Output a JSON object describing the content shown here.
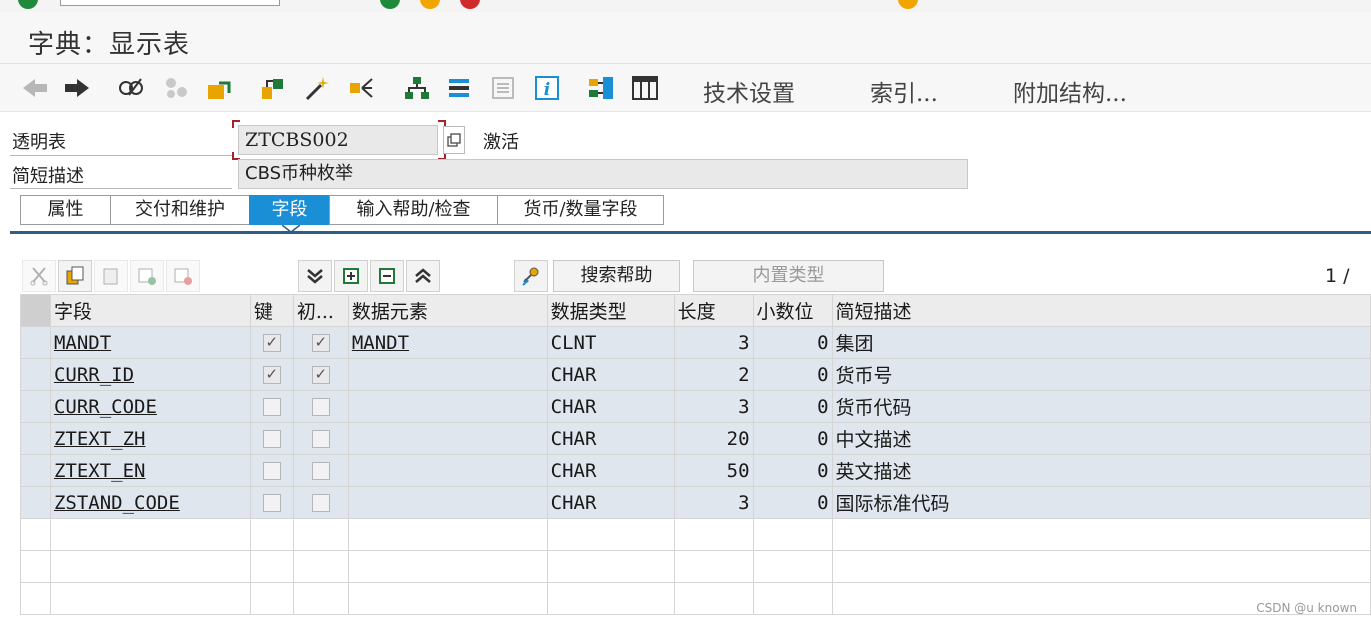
{
  "window": {
    "title": "字典：显示表"
  },
  "app_toolbar": {
    "tech_settings": "技术设置",
    "indexes": "索引...",
    "append_structures": "附加结构..."
  },
  "header": {
    "table_label": "透明表",
    "table_name": "ZTCBS002",
    "status": "激活",
    "desc_label": "简短描述",
    "desc_value": "CBS币种枚举"
  },
  "tabs": [
    "属性",
    "交付和维护",
    "字段",
    "输入帮助/检查",
    "货币/数量字段"
  ],
  "active_tab": "字段",
  "table_toolbar": {
    "search_help": "搜索帮助",
    "builtin_type": "内置类型",
    "pager": "1 /"
  },
  "columns": [
    "字段",
    "键",
    "初...",
    "数据元素",
    "数据类型",
    "长度",
    "小数位",
    "简短描述"
  ],
  "rows": [
    {
      "field": "MANDT",
      "key": true,
      "init": true,
      "element": "MANDT",
      "type": "CLNT",
      "length": "3",
      "decimals": "0",
      "desc": "集团"
    },
    {
      "field": "CURR_ID",
      "key": true,
      "init": true,
      "element": "",
      "type": "CHAR",
      "length": "2",
      "decimals": "0",
      "desc": "货币号"
    },
    {
      "field": "CURR_CODE",
      "key": false,
      "init": false,
      "element": "",
      "type": "CHAR",
      "length": "3",
      "decimals": "0",
      "desc": "货币代码"
    },
    {
      "field": "ZTEXT_ZH",
      "key": false,
      "init": false,
      "element": "",
      "type": "CHAR",
      "length": "20",
      "decimals": "0",
      "desc": "中文描述"
    },
    {
      "field": "ZTEXT_EN",
      "key": false,
      "init": false,
      "element": "",
      "type": "CHAR",
      "length": "50",
      "decimals": "0",
      "desc": "英文描述"
    },
    {
      "field": "ZSTAND_CODE",
      "key": false,
      "init": false,
      "element": "",
      "type": "CHAR",
      "length": "3",
      "decimals": "0",
      "desc": "国际标准代码"
    }
  ],
  "watermark": "CSDN @u known"
}
